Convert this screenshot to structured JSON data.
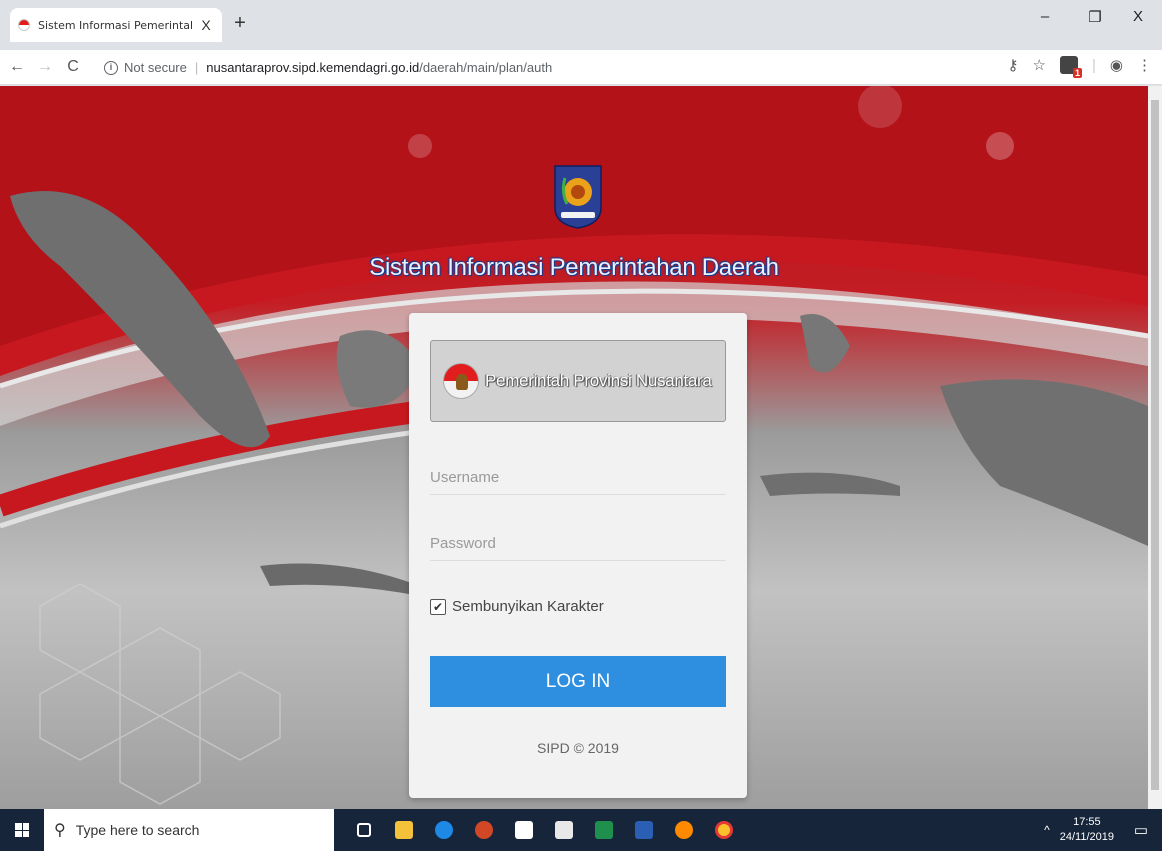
{
  "browser": {
    "tab_title": "Sistem Informasi Pemerintahan D",
    "tab_close": "X",
    "new_tab": "+",
    "security_label": "Not secure",
    "url_host": "nusantaraprov.sipd.kemendagri.go.id",
    "url_path": "/daerah/main/plan/auth",
    "icons": [
      "back-icon",
      "forward-icon",
      "reload-icon",
      "info-icon",
      "key-icon",
      "star-icon",
      "extension-icon",
      "profile-icon",
      "menu-icon"
    ],
    "extension_badge": "1",
    "window_controls": {
      "minimize": "–",
      "restore": "❐",
      "close": "X"
    }
  },
  "page": {
    "title": "Sistem Informasi Pemerintahan Daerah",
    "province_button": "Pemerintah Provinsi Nusantara",
    "username_placeholder": "Username",
    "password_placeholder": "Password",
    "hide_chars_label": "Sembunyikan Karakter",
    "hide_chars_checked": true,
    "login_label": "LOG IN",
    "copyright": "SIPD © 2019",
    "colors": {
      "primary_button": "#2e8ee0",
      "banner_red": "#c41d24",
      "title_text": "#e8f1ff"
    }
  },
  "taskbar": {
    "search_placeholder": "Type here to search",
    "time": "17:55",
    "date": "24/11/2019",
    "tray_chevron": "^",
    "apps": [
      "task-view-icon",
      "file-explorer-icon",
      "edge-icon",
      "powerpoint-icon",
      "store-icon",
      "mail-icon",
      "excel-icon",
      "word-icon",
      "firefox-icon",
      "chrome-icon"
    ]
  }
}
